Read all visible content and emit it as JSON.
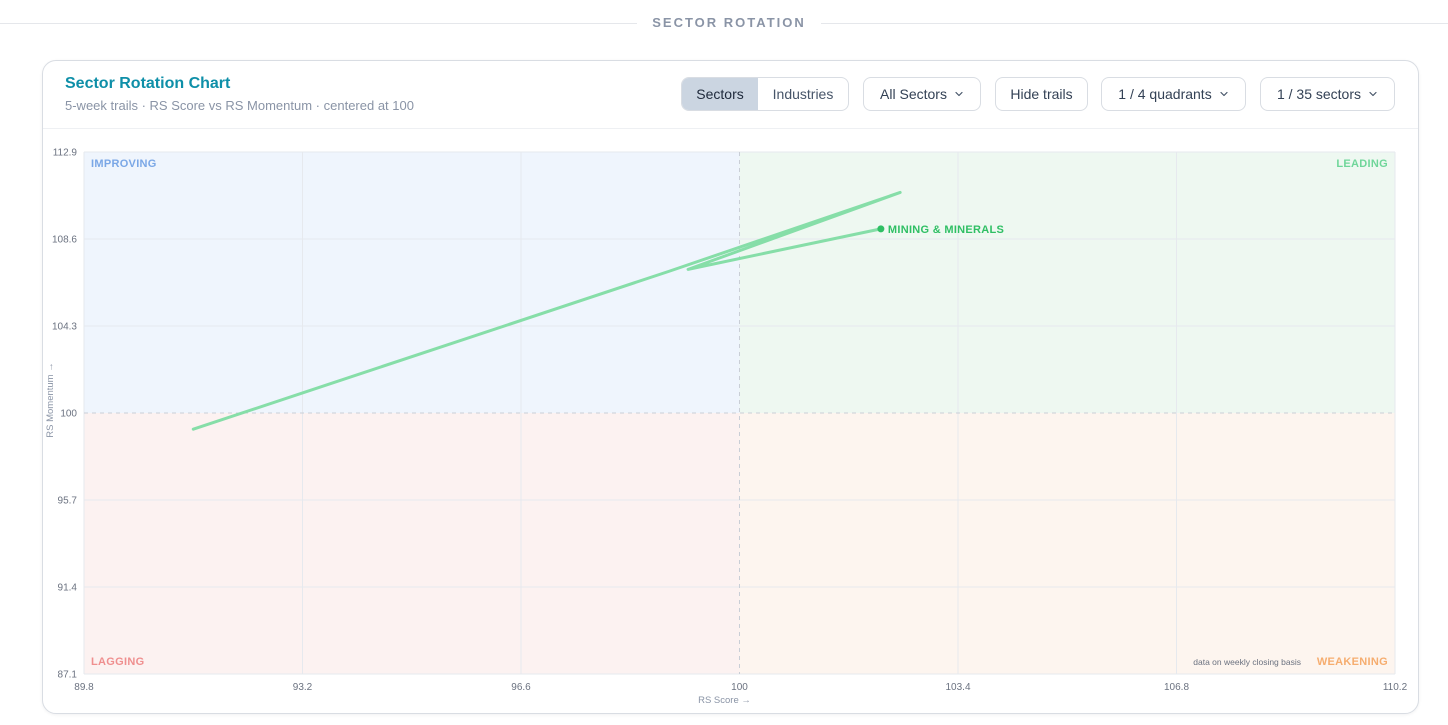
{
  "section": {
    "title": "SECTOR ROTATION"
  },
  "header": {
    "title": "Sector Rotation Chart",
    "subtitle": "5-week trails · RS Score vs RS Momentum · centered at 100"
  },
  "controls": {
    "toggle": {
      "sectors": "Sectors",
      "industries": "Industries",
      "active": "Sectors"
    },
    "sector_filter": "All Sectors",
    "hide_trails": "Hide trails",
    "quadrants": "1 / 4 quadrants",
    "sectors_count": "1 / 35 sectors",
    "chevron_icon": "chevron-down-icon"
  },
  "colors": {
    "improving_bg": "#eff5fd",
    "leading_bg": "#eef8f1",
    "lagging_bg": "#fcf2f1",
    "weakening_bg": "#fdf5ef",
    "improving_label": "#7aa7e6",
    "leading_label": "#6fd69a",
    "lagging_label": "#ef8f8f",
    "weakening_label": "#f6ad6f",
    "trail": "#86dea8",
    "point": "#2fbf64",
    "accent": "#0e8fa8"
  },
  "chart_data": {
    "type": "scatter",
    "xlabel": "RS Score →",
    "ylabel": "RS Momentum →",
    "xlim": [
      89.8,
      110.2
    ],
    "ylim": [
      87.1,
      112.9
    ],
    "x_ticks": [
      "89.8",
      "93.2",
      "96.6",
      "100",
      "103.4",
      "106.8",
      "110.2"
    ],
    "y_ticks": [
      "112.9",
      "108.6",
      "104.3",
      "100",
      "95.7",
      "91.4",
      "87.1"
    ],
    "center": 100,
    "quadrants": {
      "improving": "IMPROVING",
      "leading": "LEADING",
      "lagging": "LAGGING",
      "weakening": "WEAKENING"
    },
    "note": "data on weekly closing basis",
    "grid": true,
    "series": [
      {
        "name": "MINING & MINERALS",
        "trail": [
          {
            "x": 91.5,
            "y": 99.2
          },
          {
            "x": 98.9,
            "y": 107.0
          },
          {
            "x": 102.5,
            "y": 110.9
          },
          {
            "x": 99.2,
            "y": 107.1
          },
          {
            "x": 102.2,
            "y": 109.1
          }
        ]
      }
    ]
  }
}
